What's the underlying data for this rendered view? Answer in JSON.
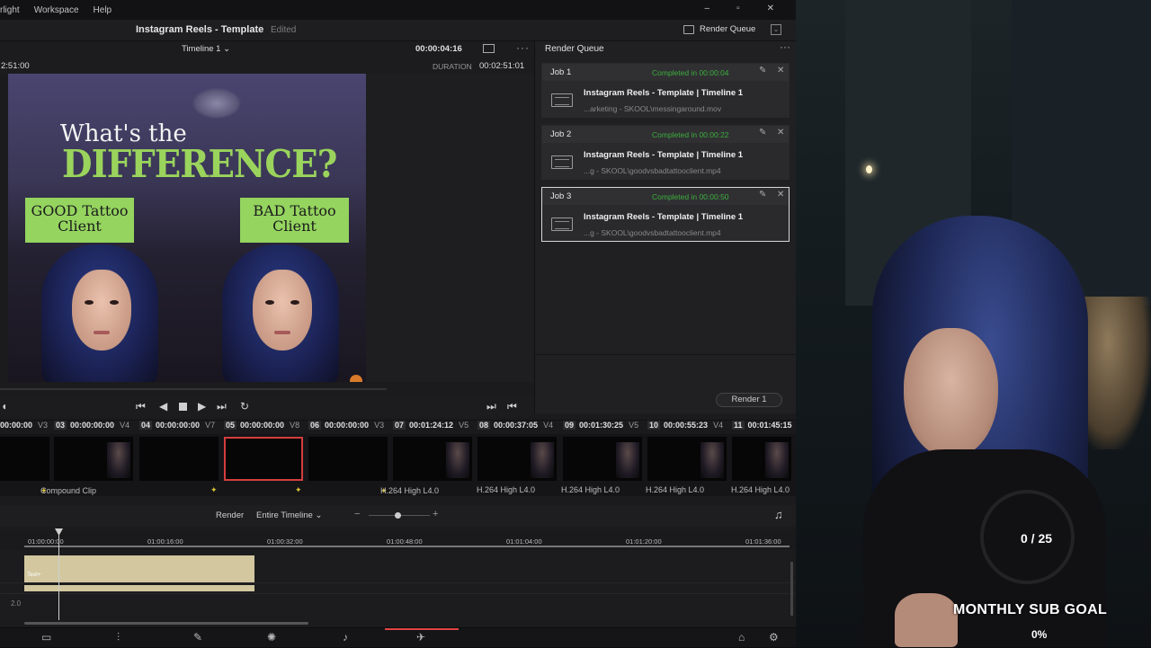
{
  "menubar": {
    "items": [
      "rlight",
      "Workspace",
      "Help"
    ]
  },
  "titlebar": {
    "project": "Instagram Reels - Template",
    "status": "Edited",
    "render_queue_button": "Render Queue"
  },
  "viewer": {
    "timeline_name": "Timeline 1",
    "timecode": "00:00:04:16",
    "left_timecode": "2:51:00",
    "duration_label": "DURATION",
    "duration_value": "00:02:51:01",
    "frame": {
      "heading_line1": "What's the",
      "heading_line2": "DIFFERENCE?",
      "label_left": "GOOD Tattoo Client",
      "label_right": "BAD Tattoo Client"
    }
  },
  "transport": {
    "icons": [
      "prev-clip-icon",
      "step-back-icon",
      "stop-icon",
      "play-icon",
      "next-clip-icon",
      "loop-icon",
      "go-end-icon",
      "go-start-icon"
    ]
  },
  "render_queue": {
    "title": "Render Queue",
    "jobs": [
      {
        "name": "Job 1",
        "status": "Completed in 00:00:04",
        "title": "Instagram Reels - Template | Timeline 1",
        "path": "...arketing - SKOOL\\messingaround.mov",
        "selected": false
      },
      {
        "name": "Job 2",
        "status": "Completed in 00:00:22",
        "title": "Instagram Reels - Template | Timeline 1",
        "path": "...g - SKOOL\\goodvsbadtattooclient.mp4",
        "selected": false
      },
      {
        "name": "Job 3",
        "status": "Completed in 00:00:50",
        "title": "Instagram Reels - Template | Timeline 1",
        "path": "...g - SKOOL\\goodvsbadtattooclient.mp4",
        "selected": true
      }
    ],
    "render_button": "Render 1"
  },
  "clips": [
    {
      "num": "",
      "tc": "00:00:00",
      "track": "V3",
      "label": "Compound Clip"
    },
    {
      "num": "03",
      "tc": "00:00:00:00",
      "track": "V4",
      "label": ""
    },
    {
      "num": "04",
      "tc": "00:00:00:00",
      "track": "V7",
      "label": ""
    },
    {
      "num": "05",
      "tc": "00:00:00:00",
      "track": "V8",
      "label": ""
    },
    {
      "num": "06",
      "tc": "00:00:00:00",
      "track": "V3",
      "label": "H.264 High L4.0"
    },
    {
      "num": "07",
      "tc": "00:01:24:12",
      "track": "V5",
      "label": "H.264 High L4.0"
    },
    {
      "num": "08",
      "tc": "00:00:37:05",
      "track": "V4",
      "label": "H.264 High L4.0"
    },
    {
      "num": "09",
      "tc": "00:01:30:25",
      "track": "V5",
      "label": "H.264 High L4.0"
    },
    {
      "num": "10",
      "tc": "00:00:55:23",
      "track": "V4",
      "label": "H.264 High L4.0"
    },
    {
      "num": "11",
      "tc": "00:01:45:15",
      "track": "",
      "label": ""
    }
  ],
  "timeline_bar": {
    "render_label": "Render",
    "render_select": "Entire Timeline"
  },
  "ruler": [
    "01:00:00:00",
    "01:00:16:00",
    "01:00:32:00",
    "01:00:48:00",
    "01:01:04:00",
    "01:01:20:00",
    "01:01:36:00"
  ],
  "tracks": {
    "text_clip": "Text+",
    "track_number": "2.0"
  },
  "pages": [
    "media-icon",
    "cut-icon",
    "edit-icon",
    "fusion-icon",
    "color-icon",
    "fairlight-icon",
    "deliver-icon"
  ],
  "overlay": {
    "count": "0 / 25",
    "label": "MONTHLY SUB GOAL",
    "percent": "0%"
  }
}
